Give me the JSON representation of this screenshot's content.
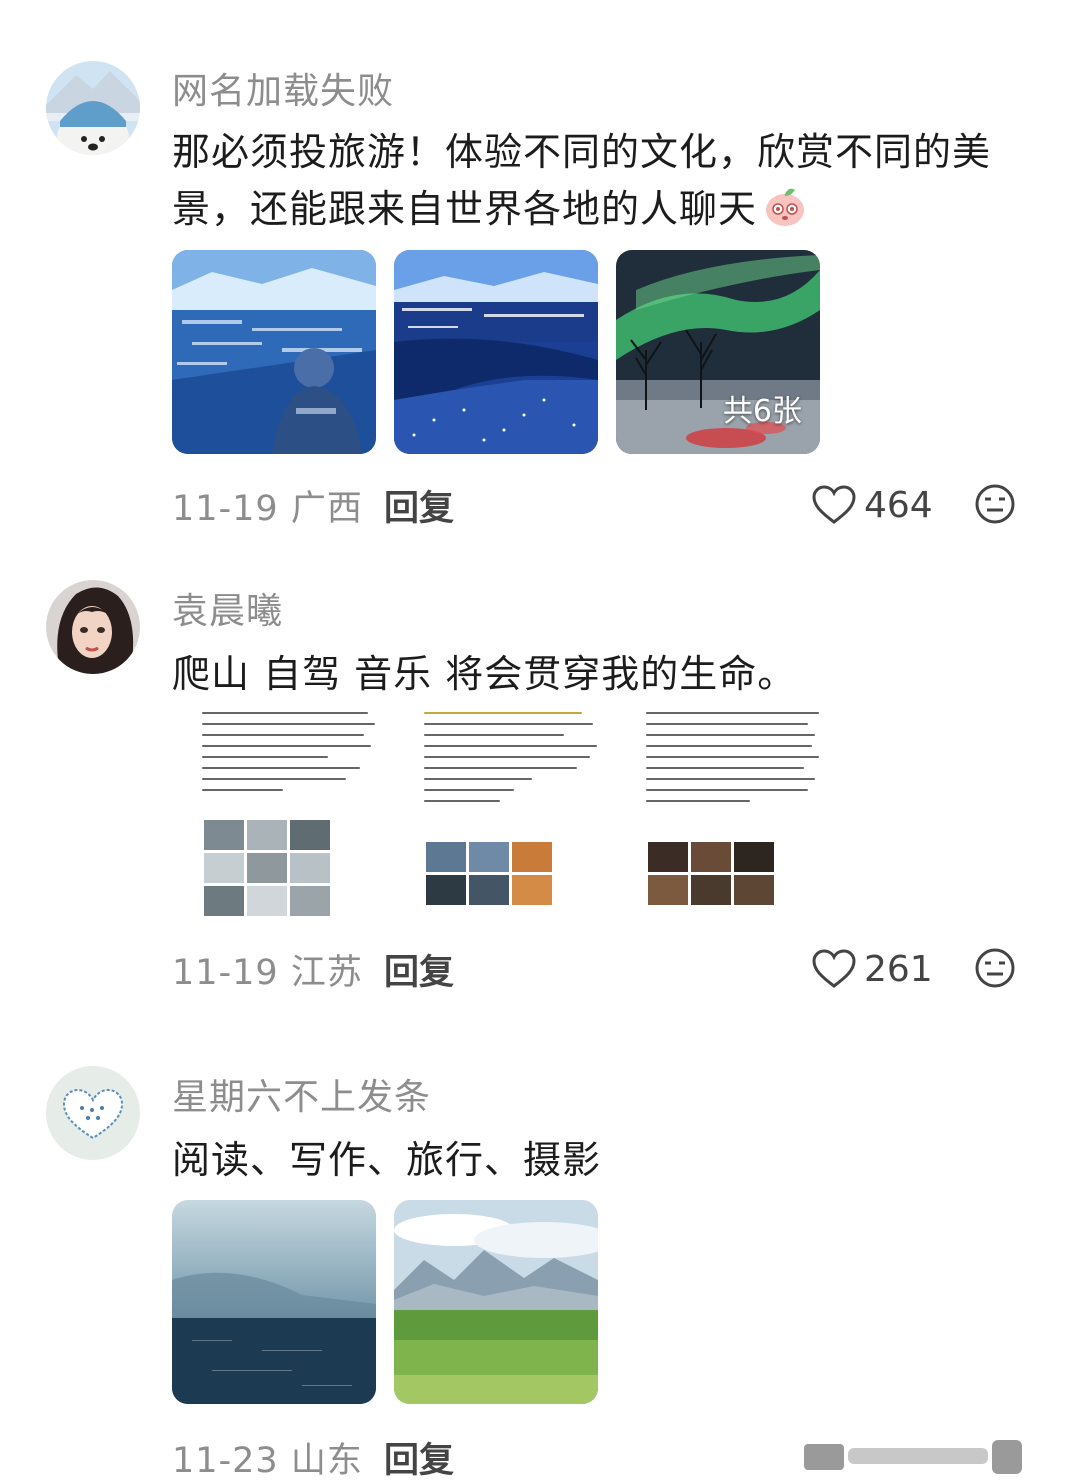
{
  "comments": [
    {
      "username": "网名加载失败",
      "text": "那必须投旅游！体验不同的文化，欣赏不同的美景，还能跟来自世界各地的人聊天",
      "date_location": "11-19 广西",
      "reply_label": "回复",
      "likes": "464",
      "image_count_label": "共6张"
    },
    {
      "username": "袁晨曦",
      "text": "爬山 自驾 音乐 将会贯穿我的生命。",
      "date_location": "11-19 江苏",
      "reply_label": "回复",
      "likes": "261"
    },
    {
      "username": "星期六不上发条",
      "text": "阅读、写作、旅行、摄影",
      "date_location": "11-23 山东",
      "reply_label": "回复"
    }
  ],
  "icons": {
    "like": "heart-outline-icon",
    "dislike": "neutral-face-icon",
    "emoji": "peach-emoji-icon"
  },
  "colors": {
    "username": "#8d8d8d",
    "text": "#1c1c1c",
    "meta": "#8d8d8d",
    "action": "#444444"
  }
}
